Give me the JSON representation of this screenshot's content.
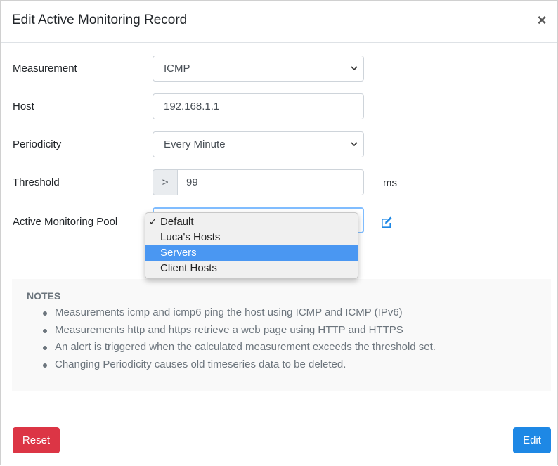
{
  "modal": {
    "title": "Edit Active Monitoring Record",
    "close_icon": "close-icon"
  },
  "form": {
    "measurement": {
      "label": "Measurement",
      "value": "ICMP"
    },
    "host": {
      "label": "Host",
      "value": "192.168.1.1"
    },
    "periodicity": {
      "label": "Periodicity",
      "value": "Every Minute"
    },
    "threshold": {
      "label": "Threshold",
      "operator": ">",
      "value": "99",
      "unit": "ms"
    },
    "pool": {
      "label": "Active Monitoring Pool",
      "options": [
        "Default",
        "Luca's Hosts",
        "Servers",
        "Client Hosts"
      ],
      "checked": "Default",
      "highlighted": "Servers",
      "checkmark": "✓",
      "edit_icon": "edit-icon"
    }
  },
  "notes": {
    "title": "NOTES",
    "items": [
      "Measurements icmp and icmp6 ping the host using ICMP and ICMP (IPv6)",
      "Measurements http and https retrieve a web page using HTTP and HTTPS",
      "An alert is triggered when the calculated measurement exceeds the threshold set.",
      "Changing Periodicity causes old timeseries data to be deleted."
    ]
  },
  "footer": {
    "reset_label": "Reset",
    "edit_label": "Edit"
  },
  "colors": {
    "danger": "#dc3545",
    "primary": "#1e88e5",
    "highlight": "#4a97f2",
    "focus": "#80bdff"
  }
}
